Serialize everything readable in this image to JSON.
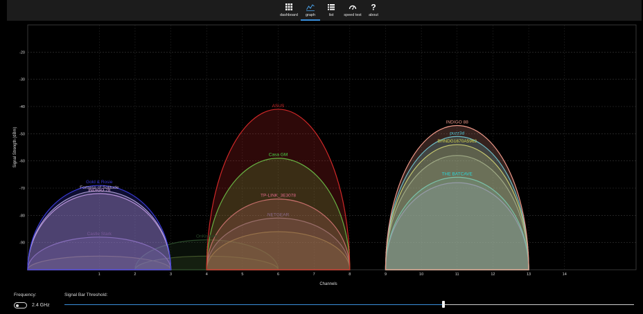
{
  "nav": {
    "items": [
      {
        "key": "dashboard",
        "label": "dashboard",
        "icon": "grid-icon"
      },
      {
        "key": "graph",
        "label": "graph",
        "icon": "graph-icon",
        "active": true
      },
      {
        "key": "list",
        "label": "list",
        "icon": "list-icon"
      },
      {
        "key": "speedtest",
        "label": "speed test",
        "icon": "speedometer-icon"
      },
      {
        "key": "about",
        "label": "about",
        "icon": "question-icon"
      }
    ]
  },
  "chart_data": {
    "type": "area",
    "xlabel": "Channels",
    "ylabel": "Signal Strength (dBm)",
    "xlim": [
      -1,
      16
    ],
    "ylim": [
      -100,
      -10
    ],
    "xticks": [
      1,
      2,
      3,
      4,
      5,
      6,
      7,
      8,
      9,
      10,
      11,
      12,
      13,
      14
    ],
    "yticks": [
      -20,
      -30,
      -40,
      -50,
      -60,
      -70,
      -80,
      -90
    ],
    "grid": true,
    "series": [
      {
        "name": "Castle Stark",
        "channel": 1,
        "dbm": -88,
        "color": "#7a5a9a"
      },
      {
        "name": "Gold & Rosie",
        "channel": 1,
        "dbm": -69,
        "color": "#3a3ad8"
      },
      {
        "name": "Fortress of Solitude",
        "channel": 1,
        "dbm": -71,
        "color": "#c8b4d2"
      },
      {
        "name": "INDIGO 78",
        "channel": 1,
        "dbm": -72,
        "color": "#e0a8e0"
      },
      {
        "name": "",
        "channel": 1,
        "dbm": -95,
        "color": "#6a5a2a"
      },
      {
        "name": "",
        "channel": 4,
        "dbm": -95,
        "color": "#4a5a2a"
      },
      {
        "name": "OnKitchen",
        "channel": 4,
        "dbm": -89,
        "color": "#2a4a2a"
      },
      {
        "name": "ASUS",
        "channel": 6,
        "dbm": -41,
        "color": "#d02828"
      },
      {
        "name": "Casa GM",
        "channel": 6,
        "dbm": -59,
        "color": "#4ad84a"
      },
      {
        "name": "TP-LINK_3E3078",
        "channel": 6,
        "dbm": -74,
        "color": "#e06a8a"
      },
      {
        "name": "NETGEAR",
        "channel": 6,
        "dbm": -81,
        "color": "#8a6a8a"
      },
      {
        "name": "",
        "channel": 6,
        "dbm": -86,
        "color": "#8a7a3a"
      },
      {
        "name": "INDIGO 88",
        "channel": 11,
        "dbm": -47,
        "color": "#f09a8a"
      },
      {
        "name": "puzz3d",
        "channel": 11,
        "dbm": -51,
        "color": "#4ac8d8"
      },
      {
        "name": "BHNDG1670A5962",
        "channel": 11,
        "dbm": -54,
        "color": "#d8d84a"
      },
      {
        "name": "",
        "channel": 11,
        "dbm": -58,
        "color": "#8a9a7a"
      },
      {
        "name": "THE BATCAVE",
        "channel": 11,
        "dbm": -66,
        "color": "#2ad8d8"
      },
      {
        "name": "",
        "channel": 11,
        "dbm": -68,
        "color": "#8a5ad8"
      }
    ]
  },
  "controls": {
    "frequency_label": "Frequency:",
    "frequency_value": "2.4 GHz",
    "threshold_label": "Signal Bar Threshold:",
    "threshold_value": 0.665
  }
}
